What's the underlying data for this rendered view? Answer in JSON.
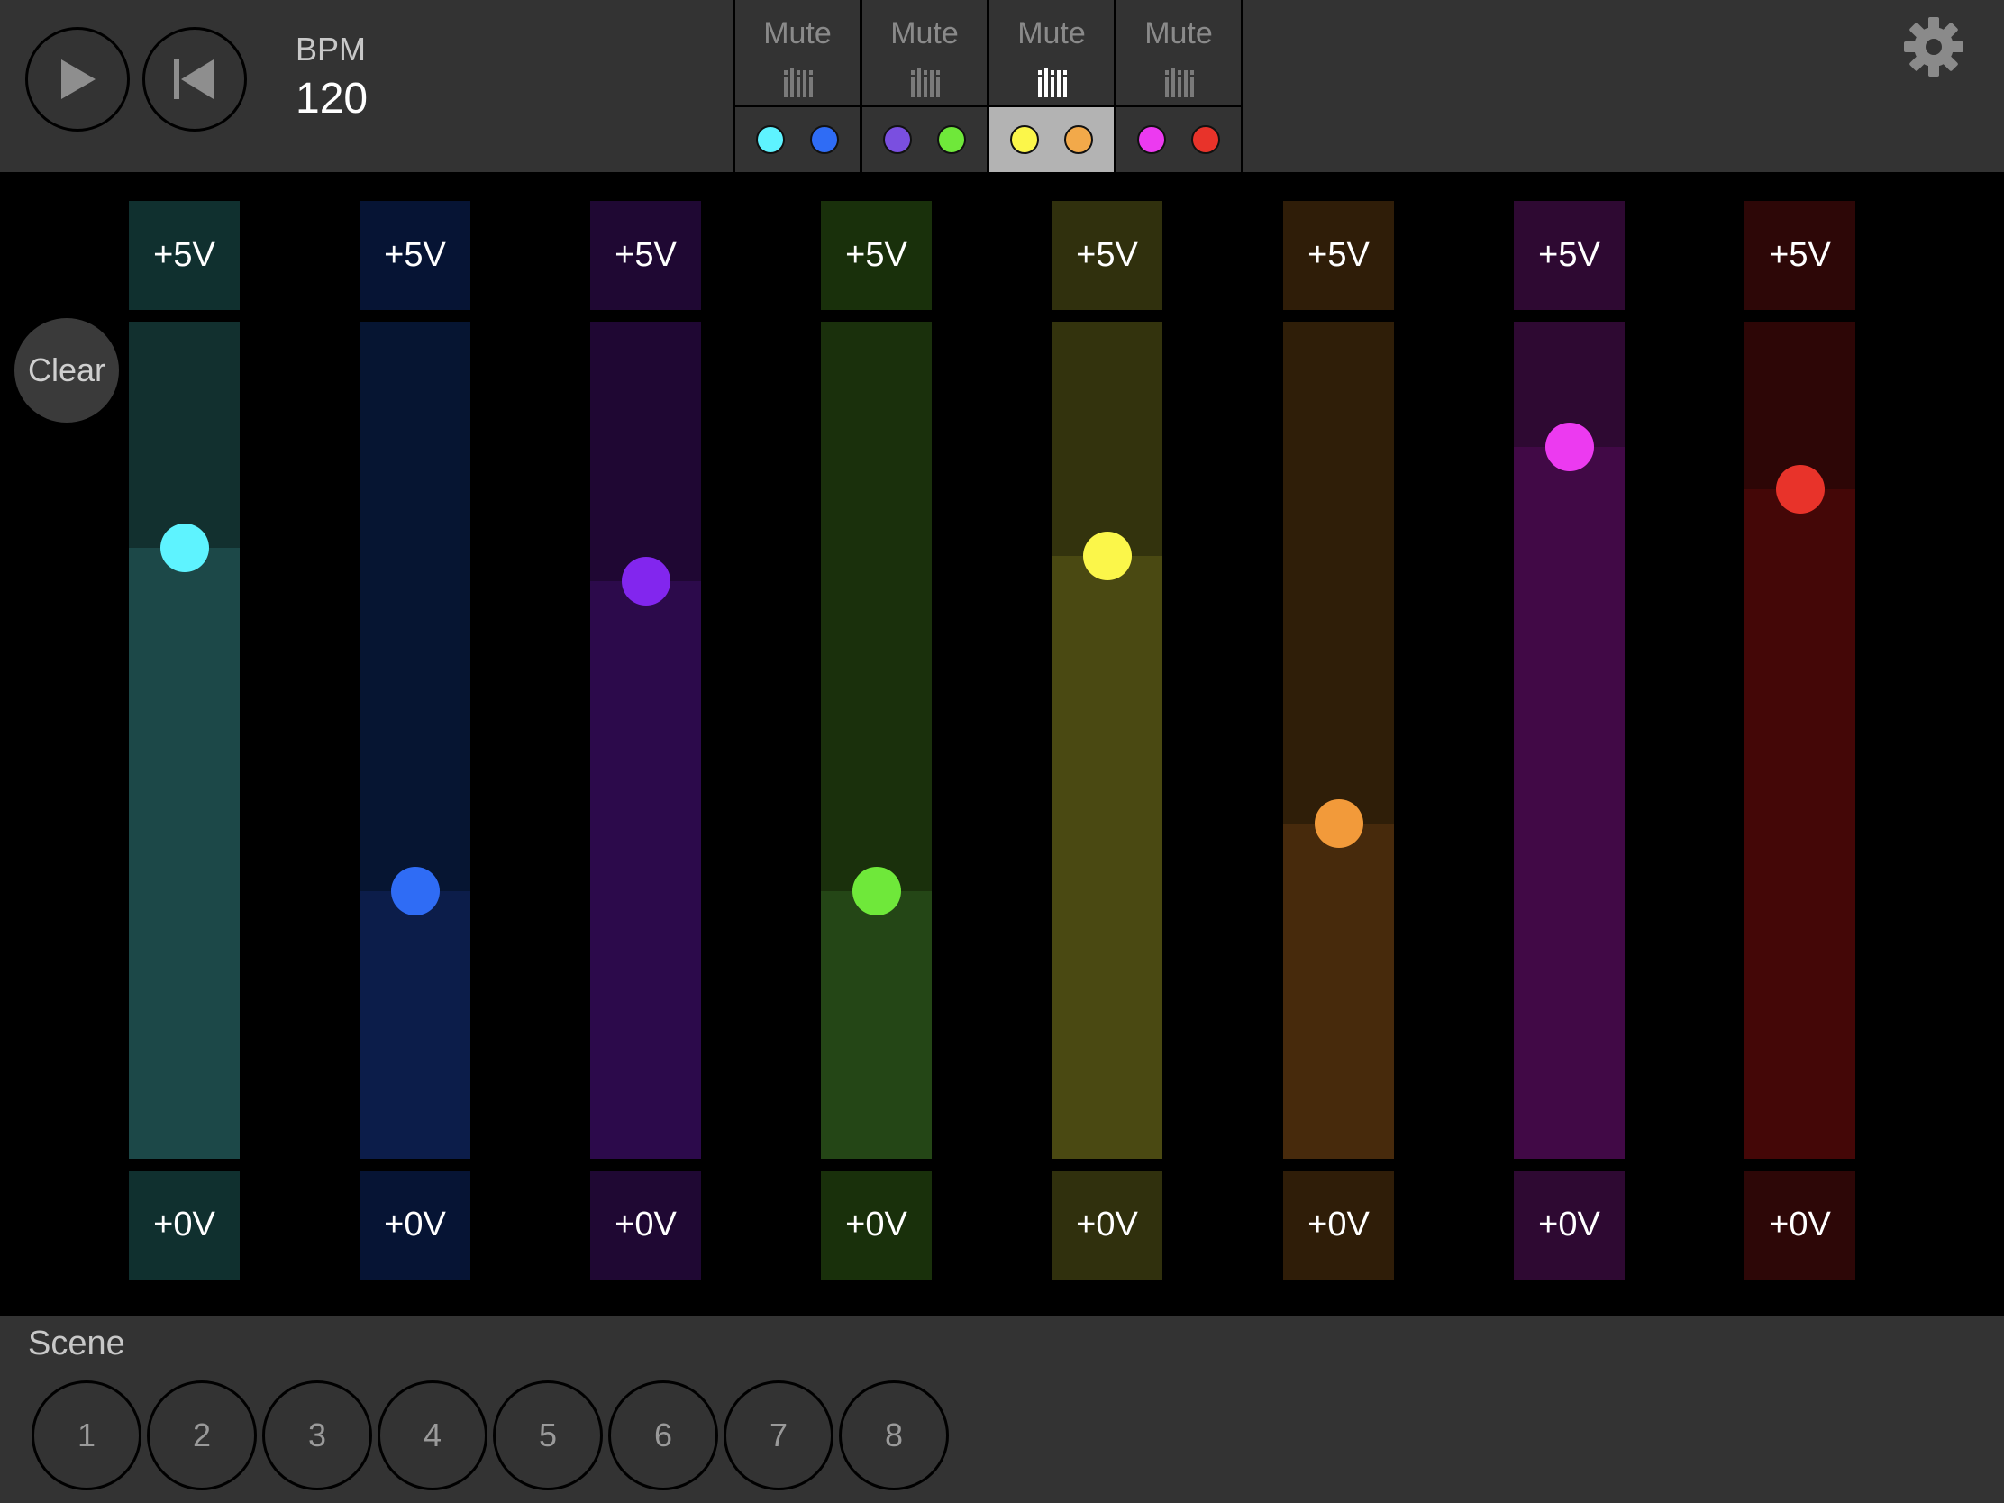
{
  "transport": {
    "bpm_label": "BPM",
    "bpm_value": "120",
    "play_icon": "play-icon",
    "rewind_icon": "skip-back-icon"
  },
  "groups": [
    {
      "mute_label": "Mute",
      "selected": false,
      "dots": [
        "#5ef3ff",
        "#2f6cf5"
      ]
    },
    {
      "mute_label": "Mute",
      "selected": false,
      "dots": [
        "#7a4fe0",
        "#6fe83a"
      ]
    },
    {
      "mute_label": "Mute",
      "selected": true,
      "dots": [
        "#fbf64a",
        "#f2a94a"
      ]
    },
    {
      "mute_label": "Mute",
      "selected": false,
      "dots": [
        "#ec3af0",
        "#e8332a"
      ]
    }
  ],
  "clear_label": "Clear",
  "channels": [
    {
      "top_label": "+5V",
      "bottom_label": "+0V",
      "level": 0.73,
      "knob": "#5ef3ff",
      "cap": "#10302f",
      "track": "#12302f",
      "fill": "#1c4848"
    },
    {
      "top_label": "+5V",
      "bottom_label": "+0V",
      "level": 0.32,
      "knob": "#2f6cf5",
      "cap": "#061434",
      "track": "#061532",
      "fill": "#0c1d4a"
    },
    {
      "top_label": "+5V",
      "bottom_label": "+0V",
      "level": 0.69,
      "knob": "#8226ee",
      "cap": "#1f0833",
      "track": "#1f0733",
      "fill": "#2c0a4b"
    },
    {
      "top_label": "+5V",
      "bottom_label": "+0V",
      "level": 0.32,
      "knob": "#6fe83a",
      "cap": "#19300b",
      "track": "#1a300c",
      "fill": "#244616"
    },
    {
      "top_label": "+5V",
      "bottom_label": "+0V",
      "level": 0.72,
      "knob": "#fbf64a",
      "cap": "#30300d",
      "track": "#33330d",
      "fill": "#4a4912"
    },
    {
      "top_label": "+5V",
      "bottom_label": "+0V",
      "level": 0.4,
      "knob": "#f29a3a",
      "cap": "#2f1d08",
      "track": "#2f1e08",
      "fill": "#472a0c"
    },
    {
      "top_label": "+5V",
      "bottom_label": "+0V",
      "level": 0.85,
      "knob": "#ec3af0",
      "cap": "#2e0932",
      "track": "#2e0932",
      "fill": "#410946"
    },
    {
      "top_label": "+5V",
      "bottom_label": "+0V",
      "level": 0.8,
      "knob": "#e8332a",
      "cap": "#2d0707",
      "track": "#2d0606",
      "fill": "#440707"
    }
  ],
  "scene": {
    "label": "Scene",
    "buttons": [
      "1",
      "2",
      "3",
      "4",
      "5",
      "6",
      "7",
      "8"
    ]
  },
  "settings_icon": "gear-icon"
}
